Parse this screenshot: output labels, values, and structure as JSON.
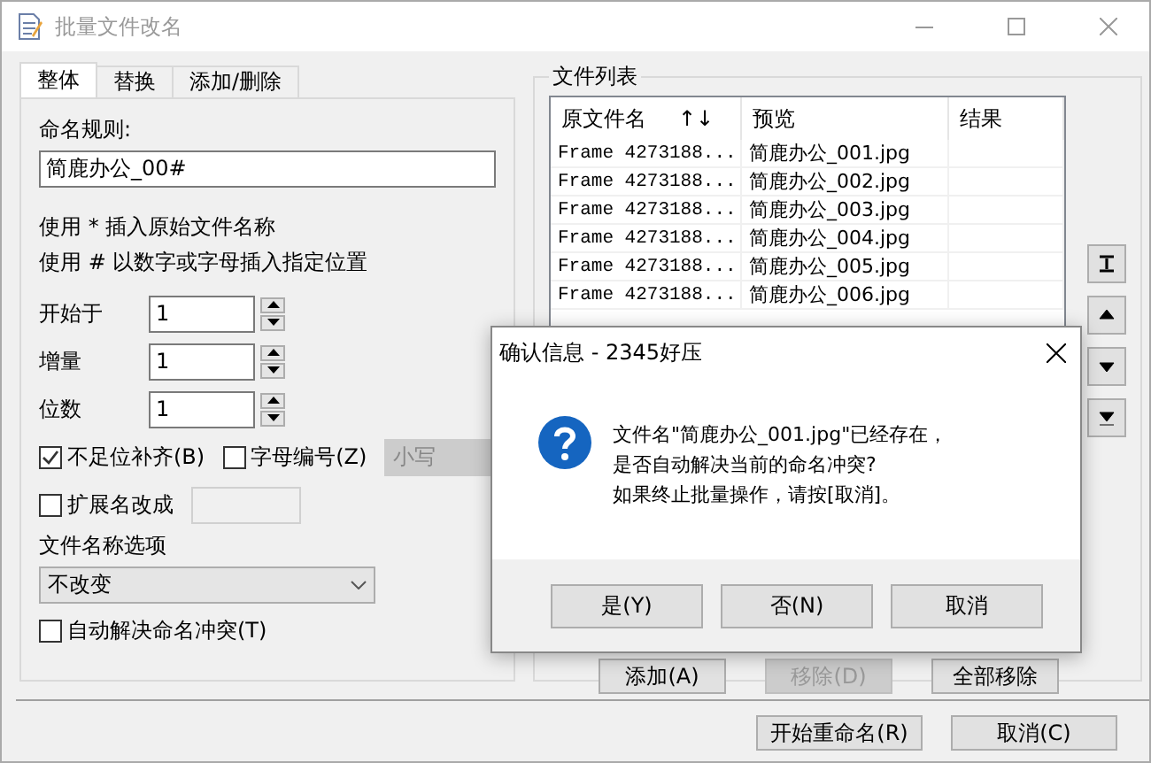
{
  "window": {
    "title": "批量文件改名",
    "active": false
  },
  "tabs": [
    {
      "label": "整体",
      "selected": true
    },
    {
      "label": "替换",
      "selected": false
    },
    {
      "label": "添加/删除",
      "selected": false
    }
  ],
  "naming_rule": {
    "label": "命名规则:",
    "value": "简鹿办公_00#"
  },
  "hints": [
    "使用 * 插入原始文件名称",
    "使用 # 以数字或字母插入指定位置"
  ],
  "spinners": [
    {
      "label": "开始于",
      "value": "1"
    },
    {
      "label": "增量",
      "value": "1"
    },
    {
      "label": "位数",
      "value": "1"
    }
  ],
  "pad_checkbox": {
    "label": "不足位补齐(B)",
    "checked": true
  },
  "letter_checkbox": {
    "label": "字母编号(Z)",
    "checked": false
  },
  "case_select": {
    "value": "小写",
    "disabled": true
  },
  "extension_checkbox": {
    "label": "扩展名改成",
    "checked": false
  },
  "filename_options": {
    "label": "文件名称选项",
    "value": "不改变"
  },
  "auto_resolve": {
    "label": "自动解决命名冲突(T)",
    "checked": false
  },
  "file_list": {
    "title": "文件列表",
    "columns": [
      "原文件名",
      "预览",
      "结果"
    ],
    "sort_indicator": "↑↓",
    "rows": [
      {
        "original": "Frame 4273188...",
        "preview": "简鹿办公_001.jpg"
      },
      {
        "original": "Frame 4273188...",
        "preview": "简鹿办公_002.jpg"
      },
      {
        "original": "Frame 4273188...",
        "preview": "简鹿办公_003.jpg"
      },
      {
        "original": "Frame 4273188...",
        "preview": "简鹿办公_004.jpg"
      },
      {
        "original": "Frame 4273188...",
        "preview": "简鹿办公_005.jpg"
      },
      {
        "original": "Frame 4273188...",
        "preview": "简鹿办公_006.jpg"
      }
    ]
  },
  "list_buttons": [
    {
      "label": "添加(A)",
      "disabled": false
    },
    {
      "label": "移除(D)",
      "disabled": true
    },
    {
      "label": "全部移除",
      "disabled": false
    }
  ],
  "footer_buttons": [
    "开始重命名(R)",
    "取消(C)"
  ],
  "dialog": {
    "title": "确认信息 - 2345好压",
    "message": [
      "文件名\"简鹿办公_001.jpg\"已经存在，",
      "是否自动解决当前的命名冲突?",
      "如果终止批量操作，请按[取消]。"
    ],
    "buttons": [
      "是(Y)",
      "否(N)",
      "取消"
    ]
  }
}
